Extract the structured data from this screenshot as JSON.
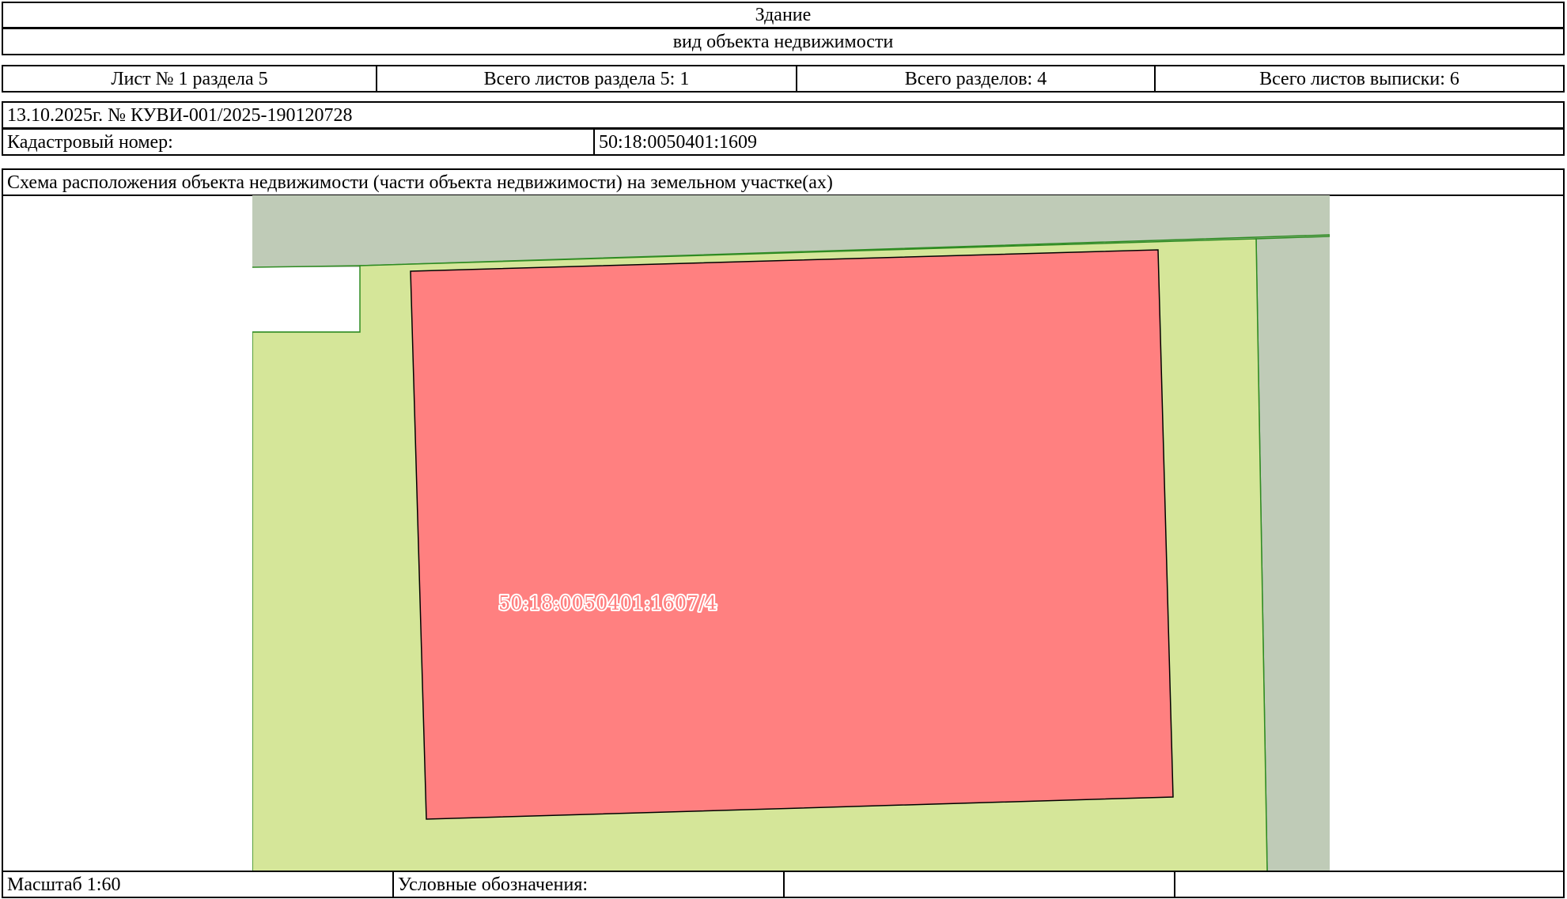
{
  "header": {
    "object_type": "Здание",
    "object_kind_caption": "вид объекта недвижимости"
  },
  "sheet_info": {
    "sheet": "Лист № 1 раздела 5",
    "section_sheets": "Всего листов раздела 5: 1",
    "total_sections": "Всего разделов: 4",
    "total_sheets": "Всего листов выписки: 6"
  },
  "extract": {
    "date_number": "13.10.2025г. № КУВИ-001/2025-190120728",
    "cadastral_label": "Кадастровый номер:",
    "cadastral_value": "50:18:0050401:1609"
  },
  "scheme": {
    "title": "Схема расположения объекта недвижимости (части объекта недвижимости) на земельном участке(ах)",
    "parcel_label": "50:18:0050401:1607/4",
    "colors": {
      "background": "#bfcbb7",
      "land_plot": "#d5e699",
      "land_plot_border": "#2e8b22",
      "building": "#ff8080",
      "building_border": "#000000"
    }
  },
  "footer": {
    "scale": "Масштаб 1:60",
    "legend_label": "Условные обозначения:",
    "legend_cell_3": "",
    "legend_cell_4": ""
  }
}
